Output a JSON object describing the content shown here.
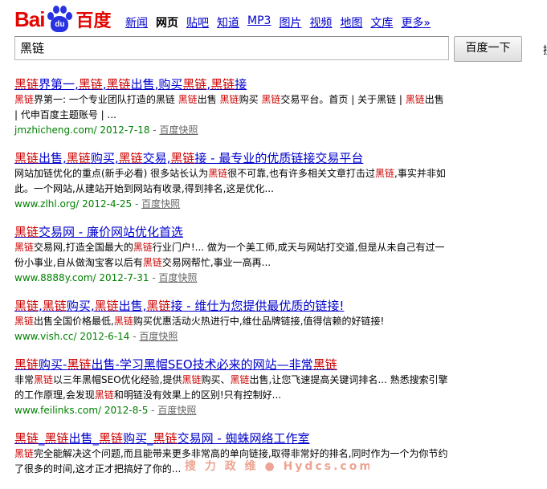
{
  "logo": {
    "bai": "Bai",
    "du": "du",
    "cn": "百度"
  },
  "nav": [
    "新闻",
    "网页",
    "贴吧",
    "知道",
    "MP3",
    "图片",
    "视频",
    "地图",
    "文库",
    "更多»"
  ],
  "search": {
    "query": "黑链",
    "button": "百度一下",
    "extra": "搜"
  },
  "results": [
    {
      "title": [
        [
          "黑链",
          true
        ],
        [
          "界第一,",
          false
        ],
        [
          "黑链",
          true
        ],
        [
          ",",
          false
        ],
        [
          "黑链",
          true
        ],
        [
          "出售,购买",
          false
        ],
        [
          "黑链",
          true
        ],
        [
          ",",
          false
        ],
        [
          "黑链",
          true
        ],
        [
          "接",
          false
        ]
      ],
      "snippet": [
        [
          "黑链",
          true
        ],
        [
          "界第一: 一个专业团队打造的黑链 ",
          false
        ],
        [
          "黑链",
          true
        ],
        [
          "出售 ",
          false
        ],
        [
          "黑链",
          true
        ],
        [
          "购买 ",
          false
        ],
        [
          "黑链",
          true
        ],
        [
          "交易平台。首页 | 关于黑链 | ",
          false
        ],
        [
          "黑链",
          true
        ],
        [
          "出售 | 代申百度主题账号 | ...",
          false
        ]
      ],
      "url": "jmzhicheng.com/",
      "date": "2012-7-18",
      "sep": "-",
      "cache": "百度快照"
    },
    {
      "title": [
        [
          "黑链",
          true
        ],
        [
          "出售,",
          false
        ],
        [
          "黑链",
          true
        ],
        [
          "购买,",
          false
        ],
        [
          "黑链",
          true
        ],
        [
          "交易,",
          false
        ],
        [
          "黑链",
          true
        ],
        [
          "接 - 最专业的优质链接交易平台",
          false
        ]
      ],
      "snippet": [
        [
          "网站加链优化的重点(新手必看) 很多站长认为",
          false
        ],
        [
          "黑链",
          true
        ],
        [
          "很不可靠,也有许多相关文章打击过",
          false
        ],
        [
          "黑链",
          true
        ],
        [
          ",事实并非如此。一个网站,从建站开始到网站有收录,得到排名,这是优化...",
          false
        ]
      ],
      "url": "www.zlhl.org/",
      "date": "2012-4-25",
      "sep": "-",
      "cache": "百度快照"
    },
    {
      "title": [
        [
          "黑链",
          true
        ],
        [
          "交易网 - 廉价网站优化首选",
          false
        ]
      ],
      "snippet": [
        [
          "黑链",
          true
        ],
        [
          "交易网,打造全国最大的",
          false
        ],
        [
          "黑链",
          true
        ],
        [
          "行业门户!... 做为一个美工师,成天与网站打交道,但是从未自己有过一份小事业,自从做淘宝客以后有",
          false
        ],
        [
          "黑链",
          true
        ],
        [
          "交易网帮忙,事业一高再...",
          false
        ]
      ],
      "url": "www.8888y.com/",
      "date": "2012-7-31",
      "sep": "-",
      "cache": "百度快照"
    },
    {
      "title": [
        [
          "黑链",
          true
        ],
        [
          ",",
          false
        ],
        [
          "黑链",
          true
        ],
        [
          "购买,",
          false
        ],
        [
          "黑链",
          true
        ],
        [
          "出售,",
          false
        ],
        [
          "黑链",
          true
        ],
        [
          "接 - 维仕为您提供最优质的链接!",
          false
        ]
      ],
      "snippet": [
        [
          "黑链",
          true
        ],
        [
          "出售全国价格最低,",
          false
        ],
        [
          "黑链",
          true
        ],
        [
          "购买优惠活动火热进行中,维仕品牌链接,值得信赖的好链接!",
          false
        ]
      ],
      "url": "www.vish.cc/",
      "date": "2012-6-14",
      "sep": "-",
      "cache": "百度快照"
    },
    {
      "title": [
        [
          "黑链",
          true
        ],
        [
          "购买-",
          false
        ],
        [
          "黑链",
          true
        ],
        [
          "出售-学习黑帽SEO技术必来的网站—非常",
          false
        ],
        [
          "黑链",
          true
        ]
      ],
      "snippet": [
        [
          "非常",
          false
        ],
        [
          "黑链",
          true
        ],
        [
          "以三年黑帽SEO优化经验,提供",
          false
        ],
        [
          "黑链",
          true
        ],
        [
          "购买、",
          false
        ],
        [
          "黑链",
          true
        ],
        [
          "出售,让您飞速提高关键词排名... 熟悉搜索引擎的工作原理,会发现",
          false
        ],
        [
          "黑链",
          true
        ],
        [
          "和明链没有效果上的区别!只有控制好...",
          false
        ]
      ],
      "url": "www.feilinks.com/",
      "date": "2012-8-5",
      "sep": "-",
      "cache": "百度快照"
    },
    {
      "title": [
        [
          "黑链",
          true
        ],
        [
          "_",
          false
        ],
        [
          "黑链",
          true
        ],
        [
          "出售_",
          false
        ],
        [
          "黑链",
          true
        ],
        [
          "购买_",
          false
        ],
        [
          "黑链",
          true
        ],
        [
          "交易网 - 蜘蛛网络工作室",
          false
        ]
      ],
      "snippet": [
        [
          "黑链",
          true
        ],
        [
          "完全能解决这个问题,而且能带来更多非常高的单向链接,取得非常好的排名,同时作为一个为你节约了很多的时间,这才正才把搞好了你的...",
          false
        ]
      ],
      "url": "",
      "date": "",
      "sep": "",
      "cache": ""
    }
  ]
}
